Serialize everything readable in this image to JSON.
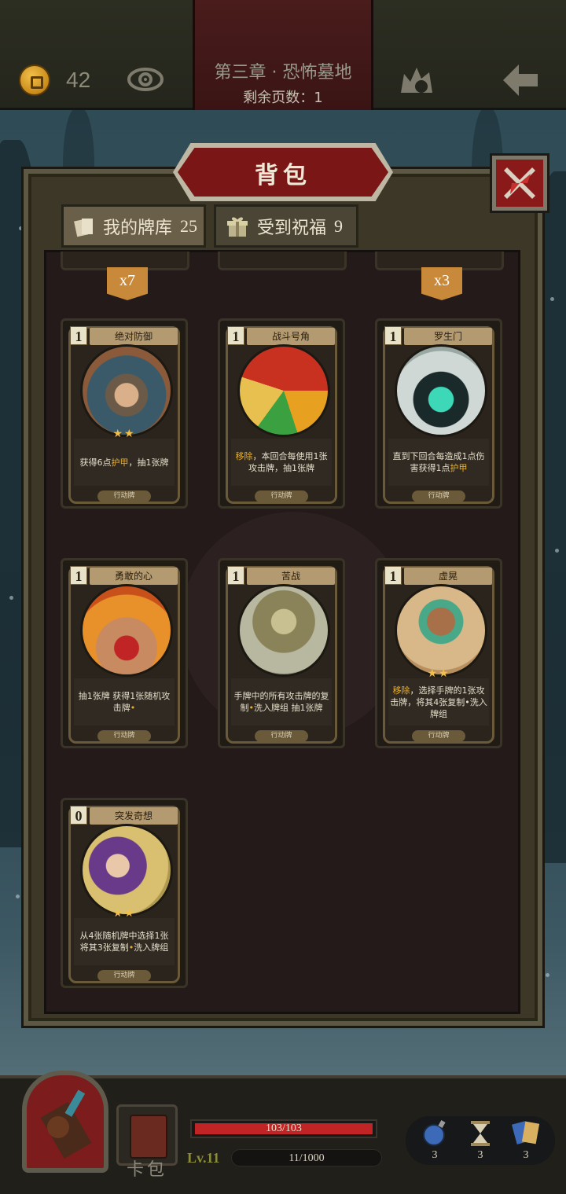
{
  "header": {
    "coins": "42",
    "chapter_title": "第三章 · 恐怖墓地",
    "pages_left": "剩余页数：1"
  },
  "panel": {
    "title": "背包",
    "tabs": [
      {
        "label": "我的牌库",
        "count": "25",
        "active": true
      },
      {
        "label": "受到祝福",
        "count": "9",
        "active": false
      }
    ],
    "partial_badges": [
      "x7",
      "x3"
    ]
  },
  "cards": [
    {
      "cost": "1",
      "name": "绝对防御",
      "stars": "★★",
      "desc_pre": "获得6点",
      "desc_hl": "护甲",
      "desc_post": "，抽1张牌",
      "type": "行动牌",
      "art": "viking-warrior"
    },
    {
      "cost": "1",
      "name": "战斗号角",
      "stars": "",
      "desc_pre": "",
      "desc_hl": "移除",
      "desc_post": "，本回合每使用1张攻击牌，抽1张牌",
      "type": "行动牌",
      "art": "war-horn"
    },
    {
      "cost": "1",
      "name": "罗生门",
      "stars": "",
      "desc_pre": "直到下回合每造成1点伤害获得1点",
      "desc_hl": "护甲",
      "desc_post": "",
      "type": "行动牌",
      "art": "demon-gate"
    },
    {
      "cost": "1",
      "name": "勇敢的心",
      "stars": "",
      "desc_pre": "抽1张牌 获得1张随机攻击牌",
      "desc_hl": "•",
      "desc_post": "",
      "type": "行动牌",
      "art": "muscle-hero"
    },
    {
      "cost": "1",
      "name": "苦战",
      "stars": "",
      "desc_pre": "手牌中的所有攻击牌的复制",
      "desc_hl": "•",
      "desc_post": "洗入牌组 抽1张牌",
      "type": "行动牌",
      "art": "mummy-fighter"
    },
    {
      "cost": "1",
      "name": "虚晃",
      "stars": "★★",
      "desc_pre": "",
      "desc_hl": "移除",
      "desc_post": "，选择手牌的1张攻击牌，将其4张复制•洗入牌组",
      "type": "行动牌",
      "art": "boxer"
    },
    {
      "cost": "0",
      "name": "突发奇想",
      "stars": "★★",
      "desc_pre": "从4张随机牌中选择1张 将其3张复制",
      "desc_hl": "•",
      "desc_post": "洗入牌组",
      "type": "行动牌",
      "art": "inventor"
    }
  ],
  "footer": {
    "cardpack_label": "卡包",
    "hp": "103/103",
    "hp_fraction": 1.0,
    "level": "Lv.11",
    "xp": "11/1000",
    "items": [
      {
        "icon": "potion-icon",
        "count": "3"
      },
      {
        "icon": "hourglass-icon",
        "count": "3"
      },
      {
        "icon": "cards-icon",
        "count": "3"
      }
    ]
  }
}
